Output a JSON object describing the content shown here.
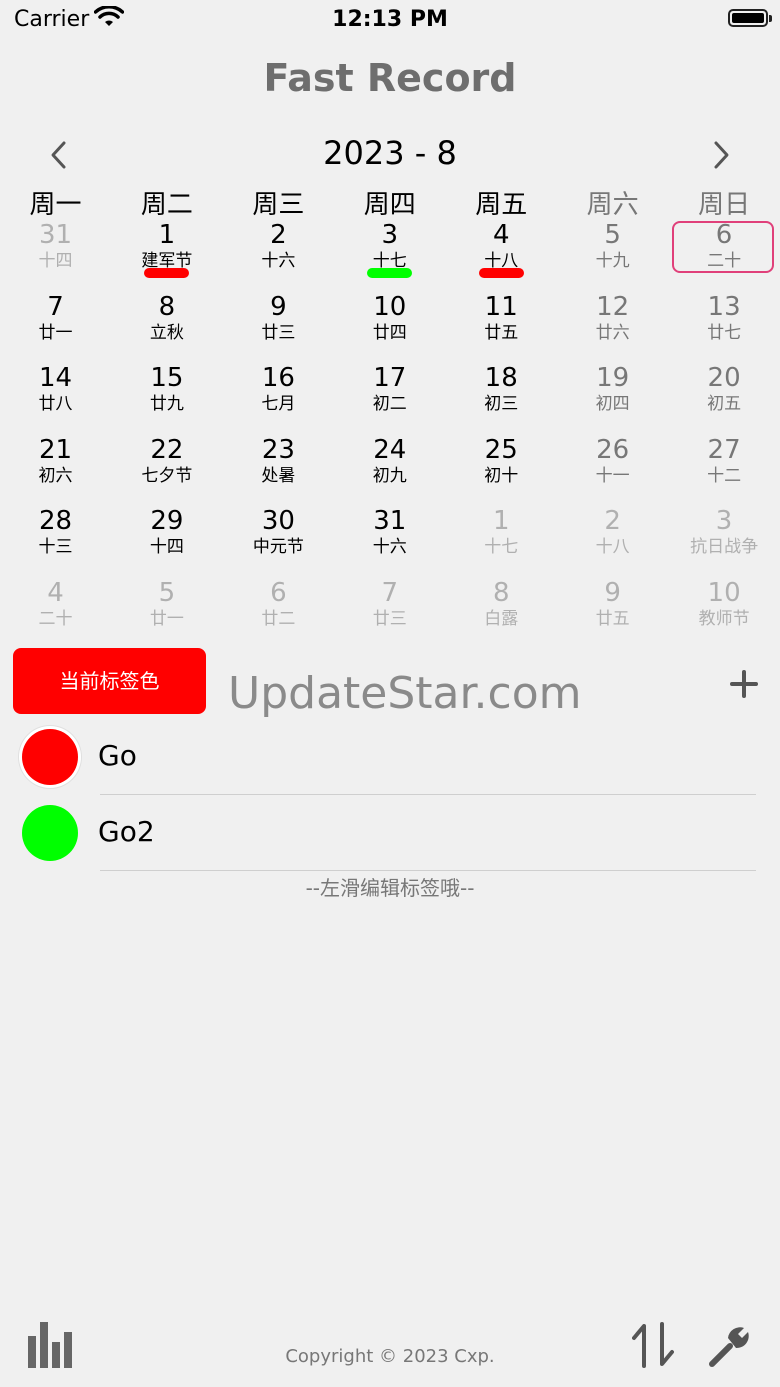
{
  "status_bar": {
    "carrier": "Carrier",
    "time": "12:13 PM"
  },
  "app_title": "Fast Record",
  "calendar": {
    "month_label": "2023 - 8",
    "weekdays": [
      "周一",
      "周二",
      "周三",
      "周四",
      "周五",
      "周六",
      "周日"
    ],
    "today_highlight": "6",
    "days": [
      {
        "num": "31",
        "lunar": "十四",
        "dim": true
      },
      {
        "num": "1",
        "lunar": "建军节",
        "mark": "#ff0000"
      },
      {
        "num": "2",
        "lunar": "十六"
      },
      {
        "num": "3",
        "lunar": "十七",
        "mark": "#00ff00"
      },
      {
        "num": "4",
        "lunar": "十八",
        "mark": "#ff0000"
      },
      {
        "num": "5",
        "lunar": "十九"
      },
      {
        "num": "6",
        "lunar": "二十",
        "today": true
      },
      {
        "num": "7",
        "lunar": "廿一"
      },
      {
        "num": "8",
        "lunar": "立秋"
      },
      {
        "num": "9",
        "lunar": "廿三"
      },
      {
        "num": "10",
        "lunar": "廿四"
      },
      {
        "num": "11",
        "lunar": "廿五"
      },
      {
        "num": "12",
        "lunar": "廿六"
      },
      {
        "num": "13",
        "lunar": "廿七"
      },
      {
        "num": "14",
        "lunar": "廿八"
      },
      {
        "num": "15",
        "lunar": "廿九"
      },
      {
        "num": "16",
        "lunar": "七月"
      },
      {
        "num": "17",
        "lunar": "初二"
      },
      {
        "num": "18",
        "lunar": "初三"
      },
      {
        "num": "19",
        "lunar": "初四"
      },
      {
        "num": "20",
        "lunar": "初五"
      },
      {
        "num": "21",
        "lunar": "初六"
      },
      {
        "num": "22",
        "lunar": "七夕节"
      },
      {
        "num": "23",
        "lunar": "处暑"
      },
      {
        "num": "24",
        "lunar": "初九"
      },
      {
        "num": "25",
        "lunar": "初十"
      },
      {
        "num": "26",
        "lunar": "十一"
      },
      {
        "num": "27",
        "lunar": "十二"
      },
      {
        "num": "28",
        "lunar": "十三"
      },
      {
        "num": "29",
        "lunar": "十四"
      },
      {
        "num": "30",
        "lunar": "中元节"
      },
      {
        "num": "31",
        "lunar": "十六"
      },
      {
        "num": "1",
        "lunar": "十七",
        "dim": true
      },
      {
        "num": "2",
        "lunar": "十八",
        "dim": true
      },
      {
        "num": "3",
        "lunar": "抗日战争",
        "dim": true
      },
      {
        "num": "4",
        "lunar": "二十",
        "dim": true
      },
      {
        "num": "5",
        "lunar": "廿一",
        "dim": true
      },
      {
        "num": "6",
        "lunar": "廿二",
        "dim": true
      },
      {
        "num": "7",
        "lunar": "廿三",
        "dim": true
      },
      {
        "num": "8",
        "lunar": "白露",
        "dim": true
      },
      {
        "num": "9",
        "lunar": "廿五",
        "dim": true
      },
      {
        "num": "10",
        "lunar": "教师节",
        "dim": true
      }
    ]
  },
  "tag_section": {
    "current_color_button": "当前标签色",
    "current_color": "#ff0000",
    "watermark": "UpdateStar.com",
    "tags": [
      {
        "name": "Go",
        "color": "#ff0000",
        "selected": true
      },
      {
        "name": "Go2",
        "color": "#00ff00",
        "selected": false
      }
    ],
    "hint": "--左滑编辑标签哦--"
  },
  "footer": {
    "copyright": "Copyright © 2023 Cxp."
  },
  "icons": {
    "prev": "chevron-left-icon",
    "next": "chevron-right-icon",
    "add": "plus-icon",
    "stats": "bar-chart-icon",
    "sort": "sort-arrows-icon",
    "settings": "wrench-icon"
  }
}
